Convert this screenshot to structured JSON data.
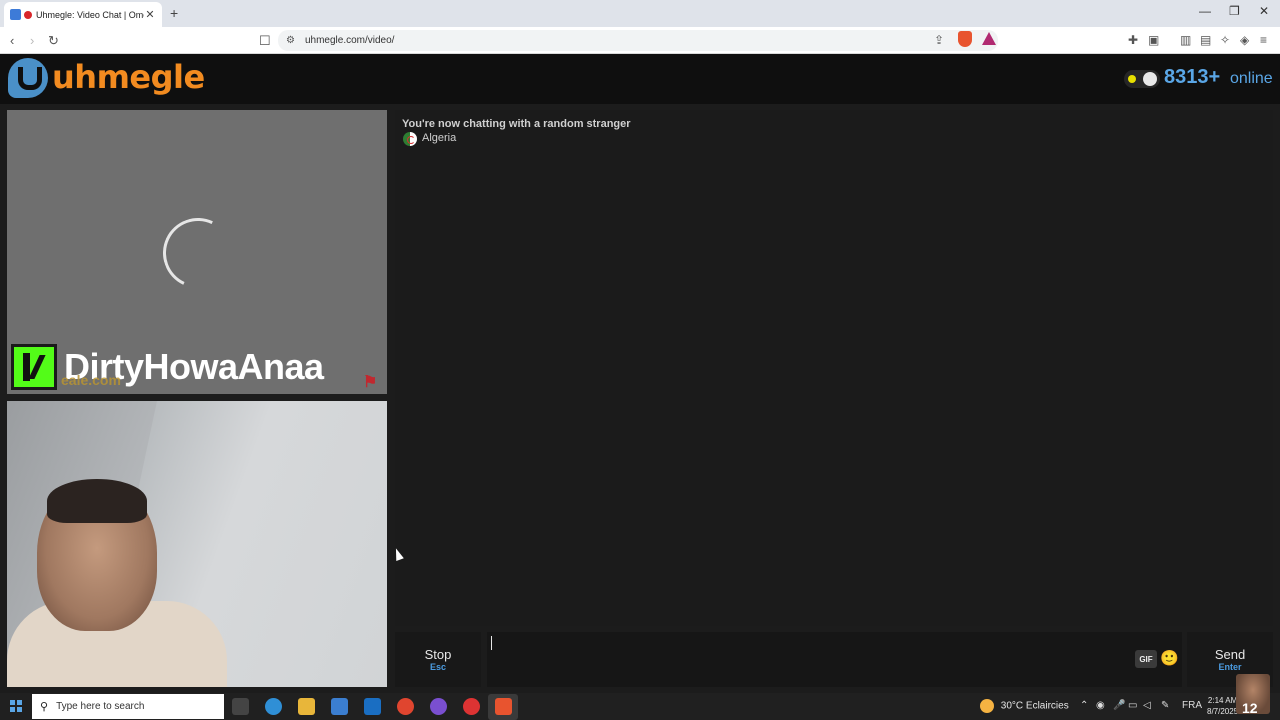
{
  "browser": {
    "tab_title": "Uhmegle: Video Chat | Omeg",
    "tab_close": "✕",
    "new_tab": "+",
    "url": "uhmegle.com/video/",
    "window_controls": [
      "—",
      "❐",
      "✕"
    ]
  },
  "site": {
    "logo_text": "uhmegle",
    "online_count": "8313+",
    "online_label": "online"
  },
  "stranger_video": {
    "overlay_name": "DirtyHowaAnaa",
    "overlay_url": "eale.com"
  },
  "chat": {
    "status": "You're now chatting with a random stranger",
    "country": "Algeria"
  },
  "controls": {
    "stop_label": "Stop",
    "stop_key": "Esc",
    "send_label": "Send",
    "send_key": "Enter",
    "gif_label": "GIF",
    "emoji": "🙂"
  },
  "taskbar": {
    "search_placeholder": "Type here to search",
    "weather_temp": "30°C",
    "weather_desc": "Eclaircies",
    "language": "FRA",
    "time": "2:14 AM",
    "date": "8/7/2025",
    "notification_count": "12"
  },
  "colors": {
    "accent_blue": "#5aa6e6",
    "logo_orange": "#f28b20",
    "kick_green": "#53fc18"
  }
}
